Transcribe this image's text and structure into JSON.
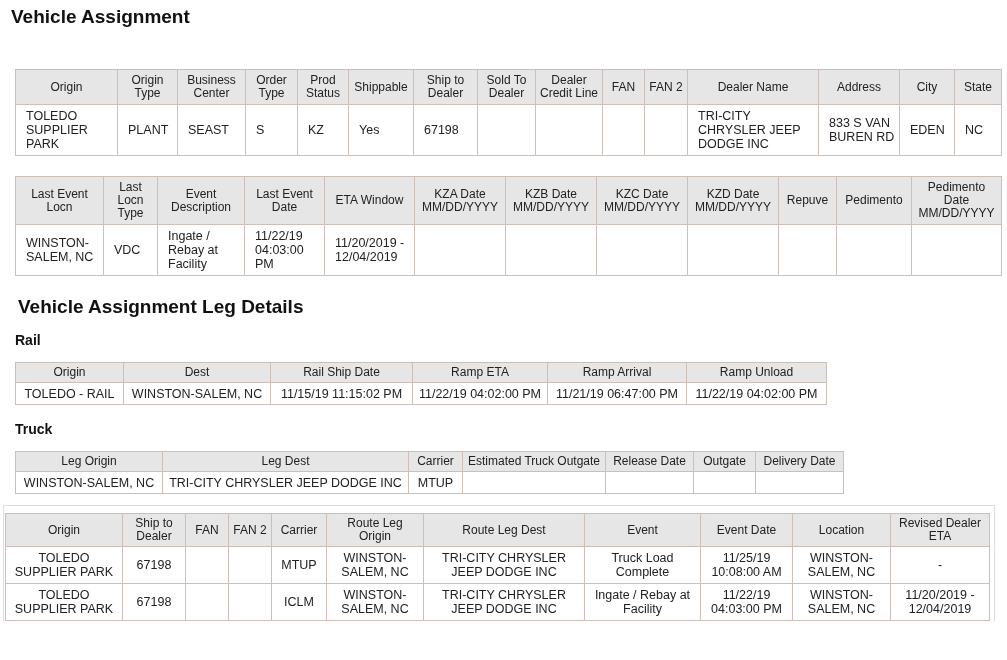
{
  "title": "Vehicle Assignment",
  "summary_tables": [
    {
      "columns": [
        "Origin",
        "Origin Type",
        "Business Center",
        "Order Type",
        "Prod Status",
        "Shippable",
        "Ship to Dealer",
        "Sold To Dealer",
        "Dealer Credit Line",
        "FAN",
        "FAN 2",
        "Dealer Name",
        "Address",
        "City",
        "State"
      ],
      "rows": [
        [
          "TOLEDO SUPPLIER PARK",
          "PLANT",
          "SEAST",
          "S",
          "KZ",
          "Yes",
          "67198",
          "",
          "",
          "",
          "",
          "TRI-CITY CHRYSLER JEEP DODGE INC",
          "833 S VAN BUREN RD",
          "EDEN",
          "NC"
        ]
      ]
    },
    {
      "columns": [
        "Last Event Locn",
        "Last Locn Type",
        "Event Description",
        "Last Event Date",
        "ETA Window",
        "KZA Date MM/DD/YYYY",
        "KZB Date MM/DD/YYYY",
        "KZC Date MM/DD/YYYY",
        "KZD Date MM/DD/YYYY",
        "Repuve",
        "Pedimento",
        "Pedimento Date MM/DD/YYYY"
      ],
      "rows": [
        [
          "WINSTON-SALEM, NC",
          "VDC",
          "Ingate / Rebay at Facility",
          "11/22/19 04:03:00 PM",
          "11/20/2019 - 12/04/2019",
          "",
          "",
          "",
          "",
          "",
          "",
          ""
        ]
      ]
    }
  ],
  "leg_details": {
    "title": "Vehicle Assignment Leg Details",
    "sections": [
      {
        "title": "Rail",
        "columns": [
          "Origin",
          "Dest",
          "Rail Ship Date",
          "Ramp ETA",
          "Ramp Arrival",
          "Ramp Unload"
        ],
        "rows": [
          [
            "TOLEDO - RAIL",
            "WINSTON-SALEM, NC",
            "11/15/19 11:15:02 PM",
            "11/22/19 04:02:00 PM",
            "11/21/19 06:47:00 PM",
            "11/22/19 04:02:00 PM"
          ]
        ]
      },
      {
        "title": "Truck",
        "columns": [
          "Leg Origin",
          "Leg Dest",
          "Carrier",
          "Estimated Truck Outgate",
          "Release Date",
          "Outgate",
          "Delivery Date"
        ],
        "rows": [
          [
            "WINSTON-SALEM, NC",
            "TRI-CITY CHRYSLER JEEP DODGE INC",
            "MTUP",
            "",
            "",
            "",
            ""
          ]
        ]
      }
    ]
  },
  "events_table": {
    "columns": [
      "Origin",
      "Ship to Dealer",
      "FAN",
      "FAN 2",
      "Carrier",
      "Route Leg Origin",
      "Route Leg Dest",
      "Event",
      "Event Date",
      "Location",
      "Revised Dealer ETA"
    ],
    "rows": [
      [
        "TOLEDO SUPPLIER PARK",
        "67198",
        "",
        "",
        "MTUP",
        "WINSTON-SALEM, NC",
        "TRI-CITY CHRYSLER JEEP DODGE INC",
        "Truck Load Complete",
        "11/25/19 10:08:00 AM",
        "WINSTON-SALEM, NC",
        "-"
      ],
      [
        "TOLEDO SUPPLIER PARK",
        "67198",
        "",
        "",
        "ICLM",
        "WINSTON-SALEM, NC",
        "TRI-CITY CHRYSLER JEEP DODGE INC",
        "Ingate / Rebay at Facility",
        "11/22/19 04:03:00 PM",
        "WINSTON-SALEM, NC",
        "11/20/2019 - 12/04/2019"
      ]
    ]
  }
}
